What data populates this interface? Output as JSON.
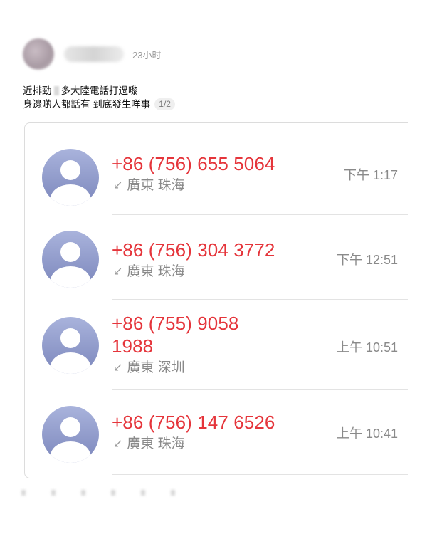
{
  "post": {
    "time": "23小时",
    "line1_a": "近排勁",
    "line1_b": "多大陸電話打過嚟",
    "line2": "身邊啲人都話有 到底發生咩事",
    "page_indicator": "1/2"
  },
  "calls": [
    {
      "number": "+86 (756) 655 5064",
      "number_line2": "",
      "location": "廣東 珠海",
      "time": "下午 1:17"
    },
    {
      "number": "+86 (756) 304 3772",
      "number_line2": "",
      "location": "廣東 珠海",
      "time": "下午 12:51"
    },
    {
      "number": "+86 (755) 9058",
      "number_line2": "1988",
      "location": "廣東 深圳",
      "time": "上午 10:51"
    },
    {
      "number": "+86 (756) 147 6526",
      "number_line2": "",
      "location": "廣東 珠海",
      "time": "上午 10:41"
    }
  ],
  "colors": {
    "number_red": "#e5353b",
    "avatar_blue": "#8f99cc"
  },
  "icons": {
    "avatar": "person-silhouette-icon",
    "call_direction": "incoming-arrow-icon"
  }
}
